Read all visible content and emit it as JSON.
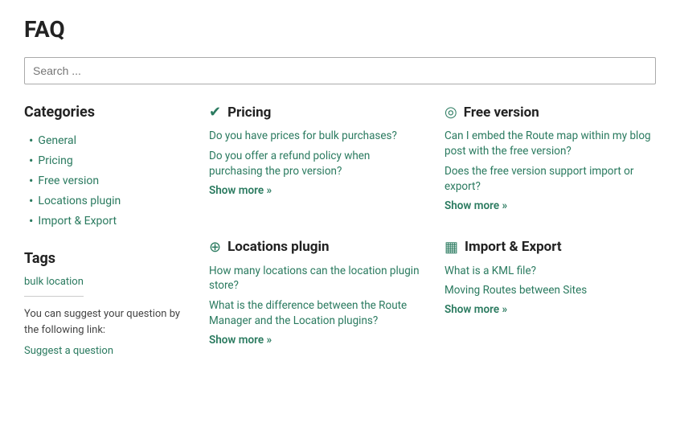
{
  "page": {
    "title": "FAQ"
  },
  "search": {
    "placeholder": "Search ..."
  },
  "sidebar": {
    "categories_heading": "Categories",
    "items": [
      {
        "label": "General",
        "href": "#"
      },
      {
        "label": "Pricing",
        "href": "#"
      },
      {
        "label": "Free version",
        "href": "#"
      },
      {
        "label": "Locations plugin",
        "href": "#"
      },
      {
        "label": "Import & Export",
        "href": "#"
      }
    ],
    "tags_heading": "Tags",
    "tag_label": "bulk location",
    "suggest_text": "You can suggest your question by the following link:",
    "suggest_link_label": "Suggest a question"
  },
  "categories": [
    {
      "id": "pricing",
      "icon": "checkmark",
      "title": "Pricing",
      "links": [
        {
          "label": "Do you have prices for bulk purchases?"
        },
        {
          "label": "Do you offer a refund policy when purchasing the pro version?"
        }
      ],
      "show_more": "Show more »"
    },
    {
      "id": "free-version",
      "icon": "spiral",
      "title": "Free version",
      "links": [
        {
          "label": "Can I embed the Route map within my blog post with the free version?"
        },
        {
          "label": "Does the free version support import or export?"
        }
      ],
      "show_more": "Show more »"
    },
    {
      "id": "locations-plugin",
      "icon": "search",
      "title": "Locations plugin",
      "links": [
        {
          "label": "How many locations can the location plugin store?"
        },
        {
          "label": "What is the difference between the Route Manager and the Location plugins?"
        }
      ],
      "show_more": "Show more »"
    },
    {
      "id": "import-export",
      "icon": "box",
      "title": "Import & Export",
      "links": [
        {
          "label": "What is a KML file?"
        },
        {
          "label": "Moving Routes between Sites"
        }
      ],
      "show_more": "Show more »"
    }
  ]
}
